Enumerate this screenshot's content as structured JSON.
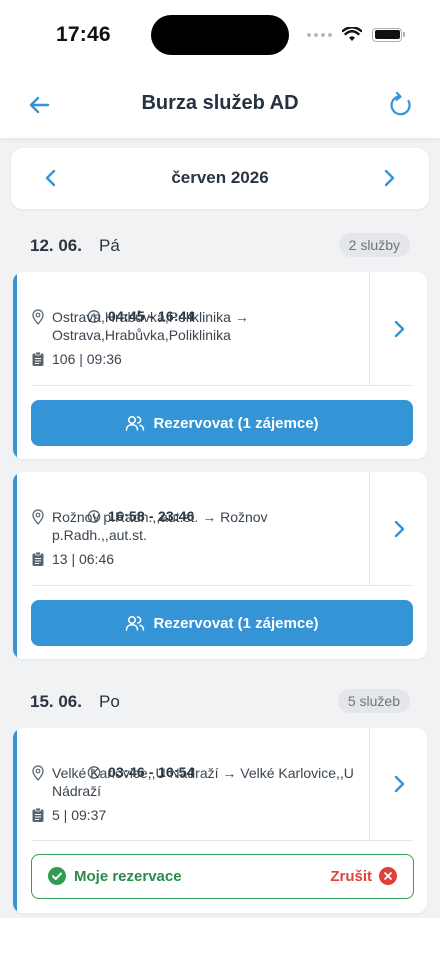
{
  "status_bar": {
    "time": "17:46"
  },
  "header": {
    "title": "Burza služeb AD"
  },
  "month_selector": {
    "label": "červen 2026"
  },
  "days": [
    {
      "date": "12. 06.",
      "weekday": "Pá",
      "count": "2 služby",
      "shifts": [
        {
          "time": "04:45 - 16:44",
          "route_line1": "Ostrava,Hrabůvka,Poliklinika →",
          "route_line2": "Ostrava,Hrabůvka,Poliklinika",
          "info": "106 | 09:36",
          "action": "Rezervovat (1 zájemce)"
        },
        {
          "time": "16:58 - 23:46",
          "route_line1": "Rožnov p.Radh.,,aut.st. → Rožnov",
          "route_line2": "p.Radh.,,aut.st.",
          "info": "13 | 06:46",
          "action": "Rezervovat (1 zájemce)"
        }
      ]
    },
    {
      "date": "15. 06.",
      "weekday": "Po",
      "count": "5 služeb",
      "shifts": [
        {
          "time": "03:46 - 16:54",
          "route_line1": "Velké Karlovice,,U Nádraží → Velké Karlovice,,U",
          "route_line2": "Nádraží",
          "info": "5 | 09:37",
          "reservation_label": "Moje rezervace",
          "cancel_label": "Zrušit"
        }
      ]
    }
  ],
  "colors": {
    "accent": "#3494d6",
    "success": "#2f9d54",
    "danger": "#e0423a",
    "background": "#f1f2f4"
  },
  "icons": [
    "back-arrow-icon",
    "refresh-icon",
    "chevron-left-icon",
    "chevron-right-icon",
    "clock-icon",
    "location-pin-icon",
    "clipboard-icon",
    "users-icon",
    "check-circle-icon",
    "close-circle-icon"
  ]
}
